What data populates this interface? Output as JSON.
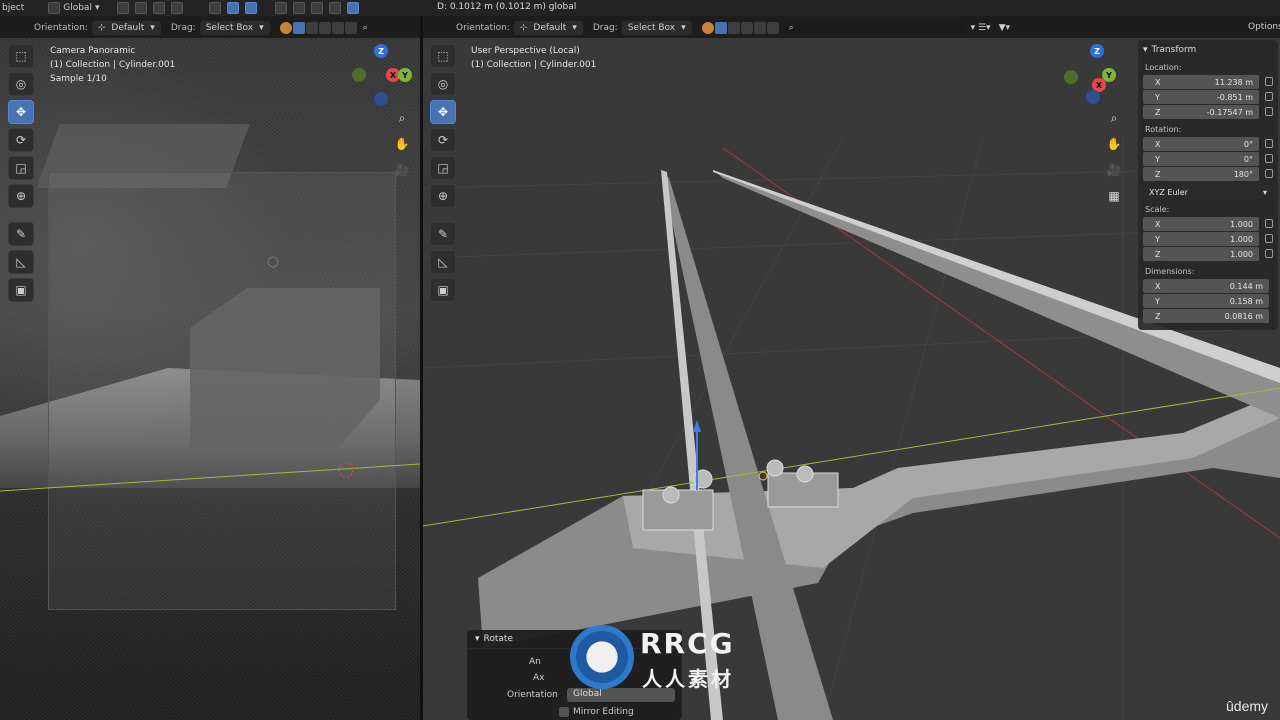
{
  "top": {
    "left_label": "bject",
    "transform_orientation": "Global",
    "measure_text": "D: 0.1012 m (0.1012 m) global"
  },
  "left_header": {
    "orientation_label": "Orientation:",
    "orientation_value": "Default",
    "drag_label": "Drag:",
    "drag_value": "Select Box"
  },
  "right_header": {
    "orientation_label": "Orientation:",
    "orientation_value": "Default",
    "drag_label": "Drag:",
    "drag_value": "Select Box",
    "options_label": "Options"
  },
  "left_viewport": {
    "line1": "Camera Panoramic",
    "line2": "(1) Collection | Cylinder.001",
    "line3": "Sample 1/10"
  },
  "right_viewport": {
    "line1": "User Perspective (Local)",
    "line2": "(1) Collection | Cylinder.001"
  },
  "gizmo": {
    "x": "X",
    "y": "Y",
    "z": "Z"
  },
  "transform_panel": {
    "title": "Transform",
    "location_label": "Location:",
    "location": [
      {
        "axis": "X",
        "value": "11.238 m"
      },
      {
        "axis": "Y",
        "value": "-0.851 m"
      },
      {
        "axis": "Z",
        "value": "-0.17547 m"
      }
    ],
    "rotation_label": "Rotation:",
    "rotation": [
      {
        "axis": "X",
        "value": "0°"
      },
      {
        "axis": "Y",
        "value": "0°"
      },
      {
        "axis": "Z",
        "value": "180°"
      }
    ],
    "rotation_mode": "XYZ Euler",
    "scale_label": "Scale:",
    "scale": [
      {
        "axis": "X",
        "value": "1.000"
      },
      {
        "axis": "Y",
        "value": "1.000"
      },
      {
        "axis": "Z",
        "value": "1.000"
      }
    ],
    "dimensions_label": "Dimensions:",
    "dimensions": [
      {
        "axis": "X",
        "value": "0.144 m"
      },
      {
        "axis": "Y",
        "value": "0.158 m"
      },
      {
        "axis": "Z",
        "value": "0.0816 m"
      }
    ]
  },
  "operator_panel": {
    "title": "Rotate",
    "angle_label": "An",
    "axis_label": "Ax",
    "orientation_label": "Orientation",
    "orientation_value": "Global",
    "mirror_label": "Mirror Editing"
  },
  "watermark": {
    "line1": "RRCG",
    "line2": "人人素材"
  },
  "brand": "ûdemy"
}
